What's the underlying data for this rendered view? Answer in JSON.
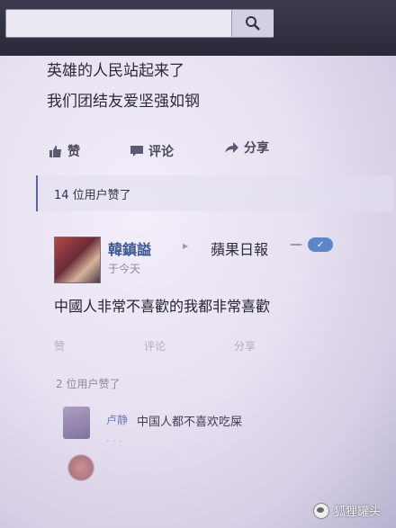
{
  "post": {
    "line1": "英雄的人民站起来了",
    "line2": "我们团结友爱坚强如钢",
    "actions": {
      "like": "赞",
      "comment": "评论",
      "share": "分享"
    },
    "likes_text": "14 位用户赞了"
  },
  "comment": {
    "author": "韓鎮謚",
    "page": "蘋果日報",
    "verified_badge": "✓",
    "timestamp": "于今天",
    "body": "中國人非常不喜歡的我都非常喜歡",
    "actions": {
      "like": "赞",
      "comment": "评论",
      "share": "分享"
    },
    "likes_text": "2 位用户赞了"
  },
  "reply": {
    "name": "卢静",
    "text": "中国人都不喜欢吃屎"
  },
  "watermark": {
    "text": "狐狸罐头"
  },
  "colors": {
    "topbar": "#2a2938",
    "link": "#3b5894",
    "accent": "#5565a8"
  }
}
